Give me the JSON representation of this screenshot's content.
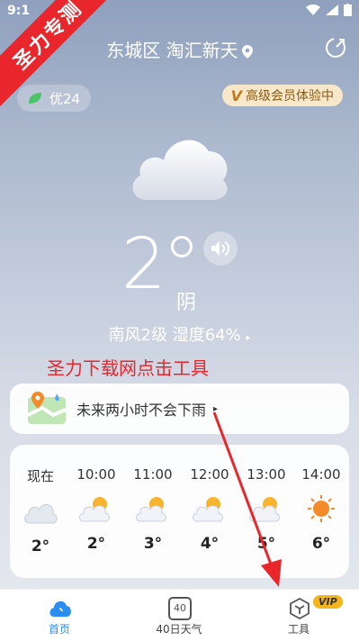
{
  "status": {
    "time": "9:1"
  },
  "watermark": {
    "text": "圣力专测"
  },
  "header": {
    "location": "东城区 淘汇新天"
  },
  "aqi": {
    "label": "优24"
  },
  "vip_trial": {
    "label": "高级会员体验中"
  },
  "current": {
    "temperature": "2",
    "sky": "阴",
    "wind_humidity": "南风2级  湿度64%"
  },
  "overlay_text": "圣力下载网点击工具",
  "rain_card": {
    "text": "未来两小时不会下雨"
  },
  "hourly": [
    {
      "time": "现在",
      "icon": "cloud-icon",
      "temp": "2°"
    },
    {
      "time": "10:00",
      "icon": "sun-cloud-icon",
      "temp": "2°"
    },
    {
      "time": "11:00",
      "icon": "sun-cloud-icon",
      "temp": "3°"
    },
    {
      "time": "12:00",
      "icon": "sun-cloud-icon",
      "temp": "4°"
    },
    {
      "time": "13:00",
      "icon": "sun-cloud-icon",
      "temp": "5°"
    },
    {
      "time": "14:00",
      "icon": "sun-icon",
      "temp": "6°"
    }
  ],
  "nav": {
    "home": "首页",
    "forecast40": "40日天气",
    "forecast40_icon_text": "40",
    "tools": "工具",
    "vip_badge": "VIP"
  },
  "colors": {
    "accent_blue": "#2a8ef0",
    "annotation_red": "#e8262b",
    "vip_gold": "#f4b41a"
  }
}
